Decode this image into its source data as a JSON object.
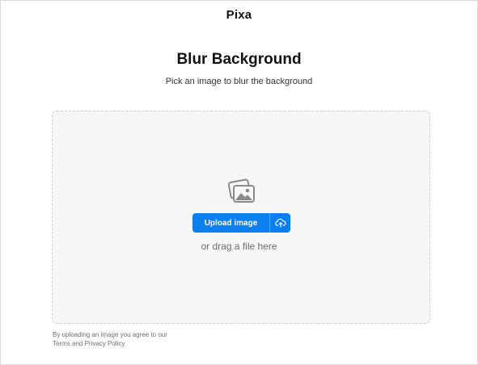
{
  "brand": {
    "name": "Pixa"
  },
  "header": {
    "title": "Blur Background",
    "subtitle": "Pick an image to blur the background"
  },
  "dropzone": {
    "icon": "image-gallery-icon",
    "upload_label": "Upload image",
    "upload_dropdown_icon": "cloud-upload-icon",
    "drag_hint": "or drag a file here"
  },
  "footer": {
    "legal_line1": "By uploading an image you agree to our",
    "legal_line2": "Terms and Privacy Policy"
  },
  "colors": {
    "accent": "#0b7ef0",
    "dropzone_bg": "#f7f7f7",
    "dropzone_border": "#cfcfcf"
  }
}
